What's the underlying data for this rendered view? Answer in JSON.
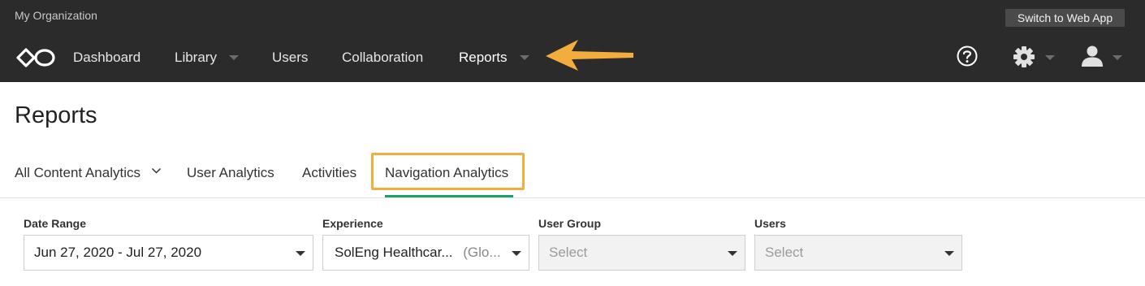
{
  "org_name": "My Organization",
  "switch_button": "Switch to Web App",
  "nav": {
    "dashboard": "Dashboard",
    "library": "Library",
    "users": "Users",
    "collaboration": "Collaboration",
    "reports": "Reports"
  },
  "colors": {
    "topbar": "#2b2b2b",
    "highlight": "#f2ad3c",
    "active_tab_underline": "#1f9e6e"
  },
  "icons": [
    "logo-icon",
    "help-icon",
    "gear-icon",
    "user-icon",
    "arrow-annotation"
  ],
  "page_title": "Reports",
  "tabs": {
    "all_content": "All Content Analytics",
    "user_analytics": "User Analytics",
    "activities": "Activities",
    "navigation": "Navigation Analytics",
    "active": "Navigation Analytics"
  },
  "filters": {
    "date_range": {
      "label": "Date Range",
      "value": "Jun 27, 2020 - Jul 27, 2020"
    },
    "experience": {
      "label": "Experience",
      "value": "SolEng Healthcar...",
      "sub": "(Glo..."
    },
    "user_group": {
      "label": "User Group",
      "placeholder": "Select"
    },
    "users": {
      "label": "Users",
      "placeholder": "Select"
    }
  }
}
